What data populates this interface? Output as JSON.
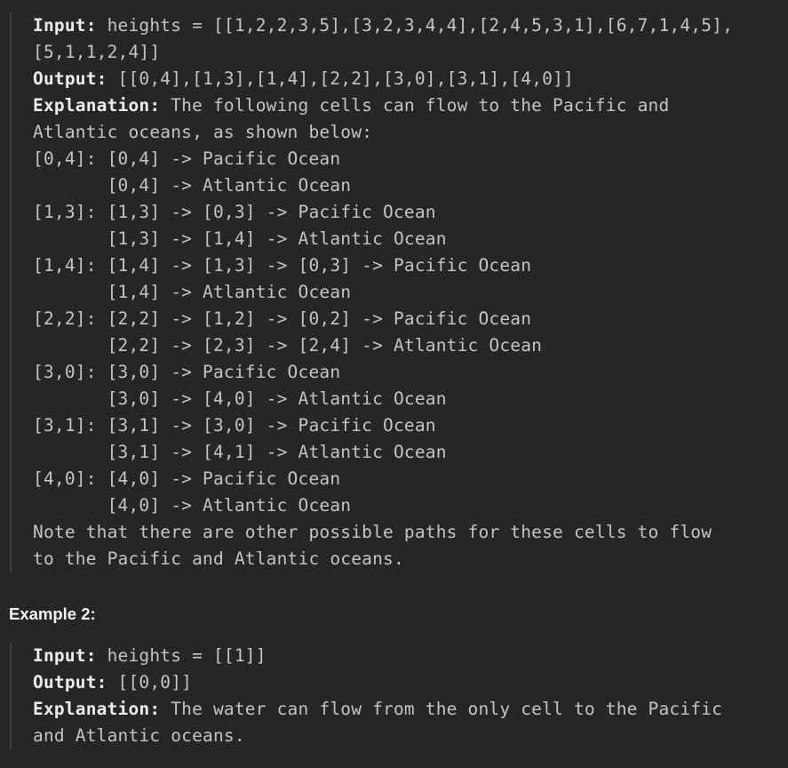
{
  "example1": {
    "input_label": "Input:",
    "input_value": " heights = [[1,2,2,3,5],[3,2,3,4,4],[2,4,5,3,1],[6,7,1,4,5],",
    "input_value_cont": "[5,1,1,2,4]]",
    "output_label": "Output:",
    "output_value": " [[0,4],[1,3],[1,4],[2,2],[3,0],[3,1],[4,0]]",
    "explanation_label": "Explanation:",
    "explanation_value": " The following cells can flow to the Pacific and",
    "explanation_cont": "Atlantic oceans, as shown below:",
    "paths": [
      "[0,4]: [0,4] -> Pacific Ocean",
      "       [0,4] -> Atlantic Ocean",
      "[1,3]: [1,3] -> [0,3] -> Pacific Ocean",
      "       [1,3] -> [1,4] -> Atlantic Ocean",
      "[1,4]: [1,4] -> [1,3] -> [0,3] -> Pacific Ocean",
      "       [1,4] -> Atlantic Ocean",
      "[2,2]: [2,2] -> [1,2] -> [0,2] -> Pacific Ocean",
      "       [2,2] -> [2,3] -> [2,4] -> Atlantic Ocean",
      "[3,0]: [3,0] -> Pacific Ocean",
      "       [3,0] -> [4,0] -> Atlantic Ocean",
      "[3,1]: [3,1] -> [3,0] -> Pacific Ocean",
      "       [3,1] -> [4,1] -> Atlantic Ocean",
      "[4,0]: [4,0] -> Pacific Ocean",
      "       [4,0] -> Atlantic Ocean"
    ],
    "note_line1": "Note that there are other possible paths for these cells to flow",
    "note_line2": "to the Pacific and Atlantic oceans."
  },
  "example2_heading": "Example 2:",
  "example2": {
    "input_label": "Input:",
    "input_value": " heights = [[1]]",
    "output_label": "Output:",
    "output_value": " [[0,0]]",
    "explanation_label": "Explanation:",
    "explanation_value": " The water can flow from the only cell to the Pacific",
    "explanation_cont": "and Atlantic oceans."
  }
}
